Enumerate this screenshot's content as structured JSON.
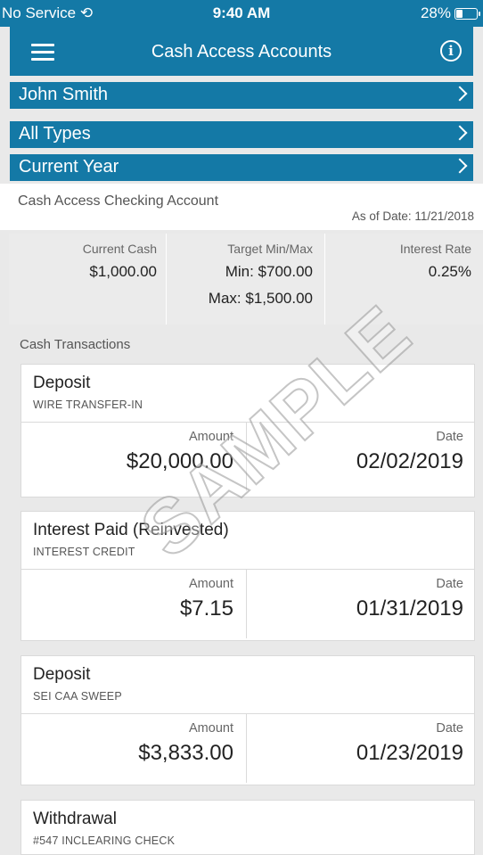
{
  "status_bar": {
    "carrier": "No Service",
    "time": "9:40 AM",
    "battery": "28%",
    "battery_level": 0.28
  },
  "header": {
    "title": "Cash Access Accounts"
  },
  "filters": [
    {
      "label": "John Smith"
    },
    {
      "label": "All Types"
    },
    {
      "label": "Current Year"
    }
  ],
  "account": {
    "title": "Cash Access Checking Account",
    "as_of": "As of Date: 11/21/2018"
  },
  "summary": {
    "current_cash_label": "Current Cash",
    "current_cash": "$1,000.00",
    "target_label": "Target Min/Max",
    "target_min": "Min: $700.00",
    "target_max": "Max: $1,500.00",
    "interest_label": "Interest Rate",
    "interest_rate": "0.25%"
  },
  "section_title": "Cash Transactions",
  "transactions": [
    {
      "type": "Deposit",
      "description": "WIRE TRANSFER-IN",
      "amount_label": "Amount",
      "amount": "$20,000.00",
      "date_label": "Date",
      "date": "02/02/2019"
    },
    {
      "type": "Interest Paid (Reinvested)",
      "description": "INTEREST CREDIT",
      "amount_label": "Amount",
      "amount": "$7.15",
      "date_label": "Date",
      "date": "01/31/2019"
    },
    {
      "type": "Deposit",
      "description": "SEI CAA SWEEP",
      "amount_label": "Amount",
      "amount": "$3,833.00",
      "date_label": "Date",
      "date": "01/23/2019"
    },
    {
      "type": "Withdrawal",
      "description": "#547 INCLEARING CHECK"
    }
  ],
  "watermark": "SAMPLE",
  "colors": {
    "brand": "#1479a6",
    "background": "#e9e9e9",
    "card": "#ffffff"
  },
  "icons": {
    "menu": "hamburger-menu-icon",
    "info": "info-icon",
    "chevron": "chevron-right-icon",
    "sync": "sync-icon",
    "battery": "battery-icon"
  }
}
